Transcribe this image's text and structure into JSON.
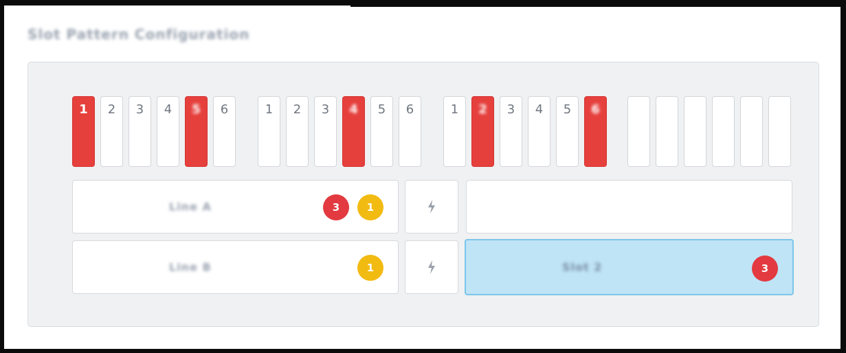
{
  "page": {
    "title": "Slot Pattern Configuration",
    "accent_red": "#e6403d",
    "accent_amber": "#f2bb12",
    "accent_blue": "#bfe4f6"
  },
  "slot_groups": [
    {
      "slots": [
        {
          "label": "1",
          "active": true
        },
        {
          "label": "2",
          "active": false
        },
        {
          "label": "3",
          "active": false
        },
        {
          "label": "4",
          "active": false
        },
        {
          "label": "5",
          "active": true
        },
        {
          "label": "6",
          "active": false
        }
      ]
    },
    {
      "slots": [
        {
          "label": "1",
          "active": false
        },
        {
          "label": "2",
          "active": false
        },
        {
          "label": "3",
          "active": false
        },
        {
          "label": "4",
          "active": true
        },
        {
          "label": "5",
          "active": false
        },
        {
          "label": "6",
          "active": false
        }
      ]
    },
    {
      "slots": [
        {
          "label": "1",
          "active": false
        },
        {
          "label": "2",
          "active": true
        },
        {
          "label": "3",
          "active": false
        },
        {
          "label": "4",
          "active": false
        },
        {
          "label": "5",
          "active": false
        },
        {
          "label": "6",
          "active": true
        }
      ]
    },
    {
      "slots": [
        {
          "label": "",
          "active": false
        },
        {
          "label": "",
          "active": false
        },
        {
          "label": "",
          "active": false
        },
        {
          "label": "",
          "active": false
        },
        {
          "label": "",
          "active": false
        },
        {
          "label": "",
          "active": false
        }
      ]
    }
  ],
  "rows": [
    {
      "left": {
        "label": "Line A",
        "badges": [
          {
            "value": "3",
            "color": "red"
          },
          {
            "value": "1",
            "color": "amber"
          }
        ]
      },
      "connector_icon": "bolt-icon",
      "right": {
        "label": "",
        "selected": false,
        "badges": []
      }
    },
    {
      "left": {
        "label": "Line B",
        "badges": [
          {
            "value": "1",
            "color": "amber"
          }
        ]
      },
      "connector_icon": "bolt-icon",
      "right": {
        "label": "Slot 2",
        "selected": true,
        "badges": [
          {
            "value": "3",
            "color": "red"
          }
        ]
      }
    }
  ]
}
